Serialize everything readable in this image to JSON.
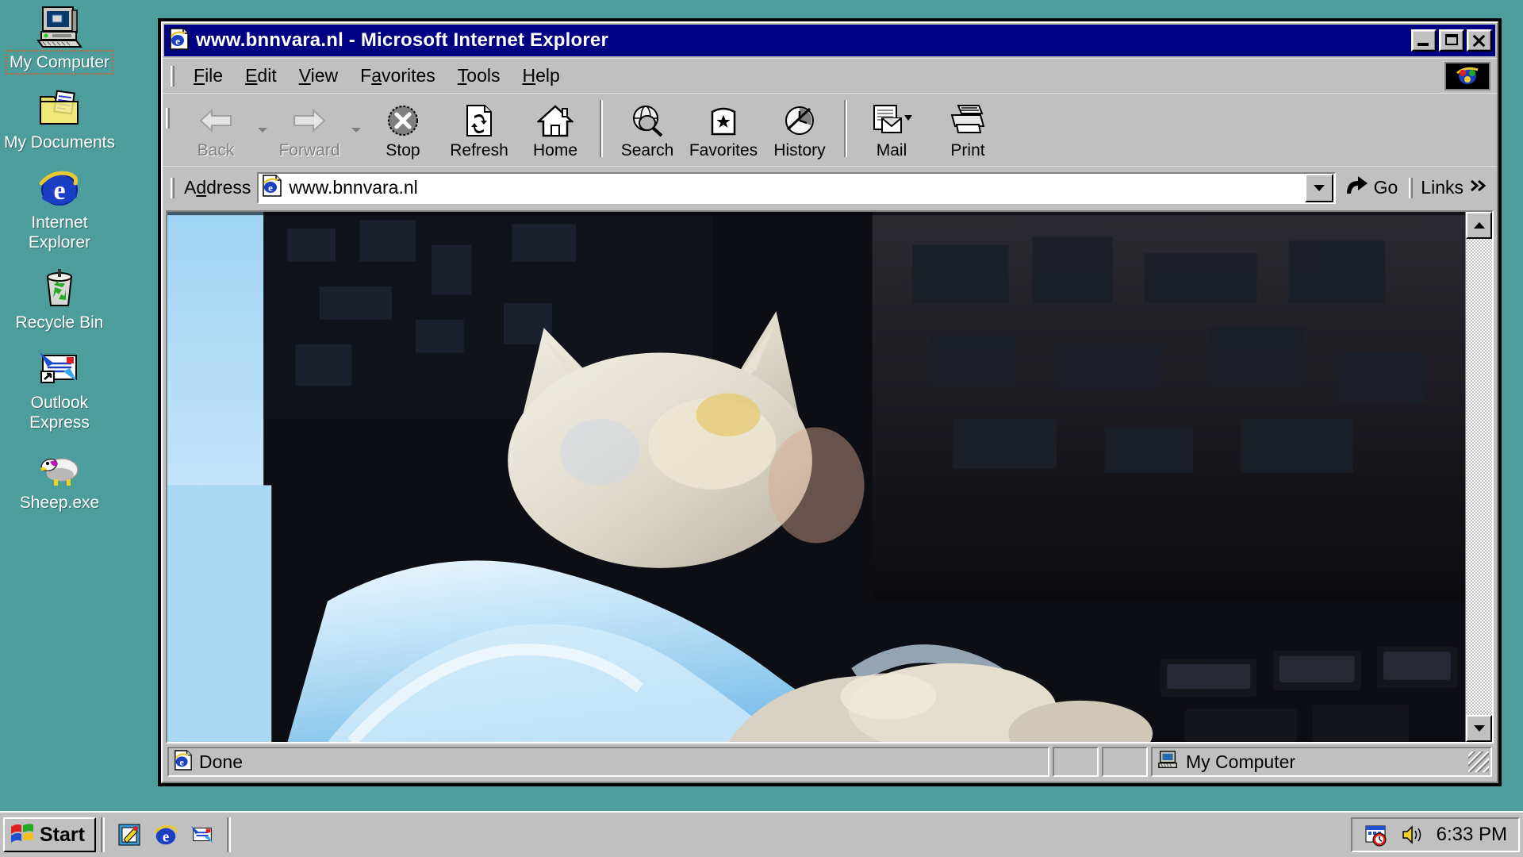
{
  "desktop": {
    "background_color": "#4d9d9d",
    "icons": [
      {
        "name": "my-computer",
        "label": "My Computer",
        "icon": "computer-icon",
        "selected": true
      },
      {
        "name": "my-documents",
        "label": "My Documents",
        "icon": "folder-documents-icon",
        "selected": false
      },
      {
        "name": "internet-explorer",
        "label": "Internet\nExplorer",
        "icon": "internet-explorer-icon",
        "selected": false
      },
      {
        "name": "recycle-bin",
        "label": "Recycle Bin",
        "icon": "recycle-bin-icon",
        "selected": false
      },
      {
        "name": "outlook-express",
        "label": "Outlook\nExpress",
        "icon": "outlook-express-icon",
        "selected": false
      },
      {
        "name": "sheep-exe",
        "label": "Sheep.exe",
        "icon": "sheep-icon",
        "selected": false
      }
    ]
  },
  "window": {
    "title": "www.bnnvara.nl - Microsoft Internet Explorer",
    "title_icon": "ie-document-icon",
    "titlebar_color": "#000082",
    "controls": {
      "minimize": "Minimize",
      "maximize": "Maximize",
      "close": "Close"
    },
    "menu": [
      {
        "label": "File",
        "accel": "F"
      },
      {
        "label": "Edit",
        "accel": "E"
      },
      {
        "label": "View",
        "accel": "V"
      },
      {
        "label": "Favorites",
        "accel": "a"
      },
      {
        "label": "Tools",
        "accel": "T"
      },
      {
        "label": "Help",
        "accel": "H"
      }
    ],
    "toolbar": [
      {
        "label": "Back",
        "icon": "arrow-left-icon",
        "disabled": true,
        "dropdown": true
      },
      {
        "label": "Forward",
        "icon": "arrow-right-icon",
        "disabled": true,
        "dropdown": true
      },
      {
        "label": "Stop",
        "icon": "stop-x-icon",
        "disabled": false,
        "dropdown": false
      },
      {
        "label": "Refresh",
        "icon": "refresh-icon",
        "disabled": false,
        "dropdown": false
      },
      {
        "label": "Home",
        "icon": "home-icon",
        "disabled": false,
        "dropdown": false
      },
      {
        "label": "Search",
        "icon": "search-globe-icon",
        "disabled": false,
        "dropdown": false
      },
      {
        "label": "Favorites",
        "icon": "favorites-folder-icon",
        "disabled": false,
        "dropdown": false
      },
      {
        "label": "History",
        "icon": "history-clock-icon",
        "disabled": false,
        "dropdown": false
      },
      {
        "label": "Mail",
        "icon": "mail-icon",
        "disabled": false,
        "dropdown": true
      },
      {
        "label": "Print",
        "icon": "printer-icon",
        "disabled": false,
        "dropdown": false
      }
    ],
    "address": {
      "label": "Address",
      "value": "www.bnnvara.nl",
      "placeholder": "",
      "icon": "ie-document-icon",
      "dropdown_icon": "chevron-down-icon",
      "go_label": "Go",
      "go_icon": "go-arrow-icon",
      "links_label": "Links",
      "links_icon": "chevron-double-right-icon"
    },
    "content": {
      "description": "cat-on-keyboard-photo",
      "scrollbar": {
        "up_icon": "triangle-up-icon",
        "down_icon": "triangle-down-icon"
      }
    },
    "statusbar": {
      "text": "Done",
      "icon": "ie-document-icon",
      "zone": "My Computer",
      "zone_icon": "computer-small-icon"
    }
  },
  "taskbar": {
    "start_label": "Start",
    "start_icon": "windows-flag-icon",
    "quicklaunch": [
      {
        "name": "show-desktop",
        "icon": "notepad-pencil-icon"
      },
      {
        "name": "launch-ie",
        "icon": "internet-explorer-icon"
      },
      {
        "name": "launch-outlook-express",
        "icon": "outlook-express-icon"
      }
    ],
    "tray": {
      "icons": [
        {
          "name": "task-scheduler",
          "icon": "scheduler-clock-icon"
        },
        {
          "name": "volume",
          "icon": "speaker-icon"
        }
      ],
      "clock": "6:33 PM"
    }
  }
}
